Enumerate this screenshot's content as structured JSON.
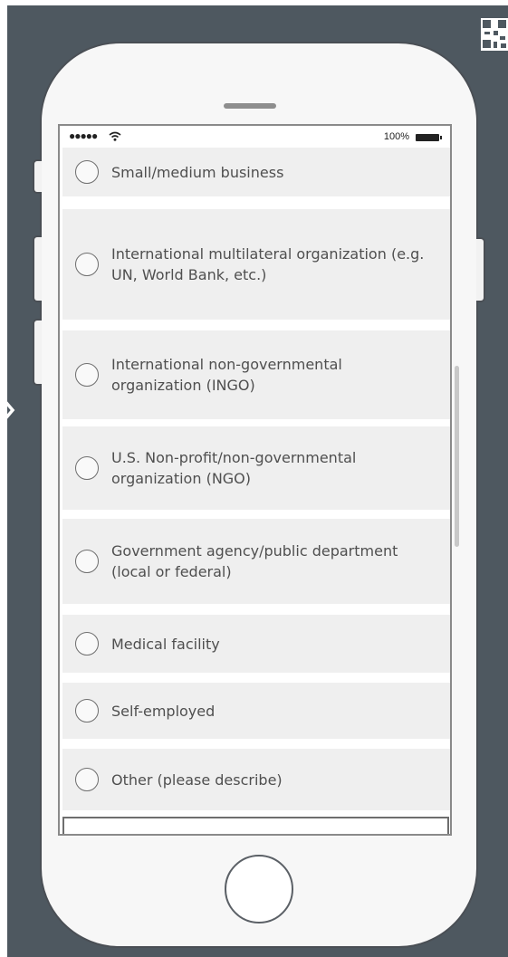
{
  "status_bar": {
    "signal": "●●●●●",
    "battery_percent": "100%"
  },
  "options": [
    {
      "label": "Small/medium business"
    },
    {
      "label": "International multilateral organization (e.g. UN, World Bank, etc.)"
    },
    {
      "label": "International non-governmental organization (INGO)"
    },
    {
      "label": "U.S. Non-profit/non-governmental organization (NGO)"
    },
    {
      "label": "Government agency/public department (local or federal)"
    },
    {
      "label": "Medical facility"
    },
    {
      "label": "Self-employed"
    },
    {
      "label": "Other (please describe)"
    }
  ],
  "other_description": {
    "value": ""
  },
  "colors": {
    "backdrop": "#4e5860",
    "phone_body": "#f7f7f7",
    "option_background": "#efefef",
    "text": "#4f4f4f"
  },
  "icons": [
    "qr-code-icon",
    "chevron-right-icon",
    "wifi-icon",
    "battery-icon",
    "radio-circle-icon"
  ]
}
